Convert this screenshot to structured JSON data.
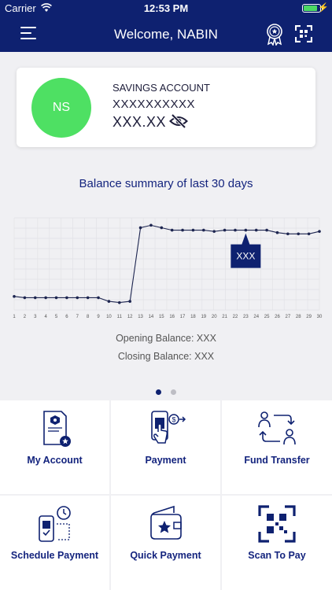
{
  "status_bar": {
    "carrier": "Carrier",
    "time": "12:53 PM"
  },
  "header": {
    "title": "Welcome, NABIN"
  },
  "account": {
    "initials": "NS",
    "type": "SAVINGS ACCOUNT",
    "number": "XXXXXXXXXX",
    "balance": "XXX.XX"
  },
  "summary": {
    "title": "Balance summary of last 30 days",
    "opening_label": "Opening Balance: XXX",
    "closing_label": "Closing Balance: XXX",
    "tooltip": "XXX"
  },
  "chart_data": {
    "type": "line",
    "x": [
      1,
      2,
      3,
      4,
      5,
      6,
      7,
      8,
      9,
      10,
      11,
      12,
      13,
      14,
      15,
      16,
      17,
      18,
      19,
      20,
      21,
      22,
      23,
      24,
      25,
      26,
      27,
      28,
      29,
      30
    ],
    "series": [
      {
        "values": [
          26,
          25,
          25,
          25,
          25,
          25,
          25,
          25,
          25,
          22,
          21,
          22,
          82,
          84,
          82,
          80,
          80,
          80,
          80,
          79,
          80,
          80,
          80,
          80,
          80,
          78,
          77,
          77,
          77,
          79
        ]
      }
    ],
    "ylim": [
      15,
      90
    ],
    "grid": true,
    "highlight_x": 23
  },
  "pagination": {
    "current": 1,
    "total": 2
  },
  "tiles": [
    {
      "label": "My Account",
      "icon": "account-document-icon"
    },
    {
      "label": "Payment",
      "icon": "phone-payment-icon"
    },
    {
      "label": "Fund Transfer",
      "icon": "fund-transfer-icon"
    },
    {
      "label": "Schedule Payment",
      "icon": "schedule-payment-icon"
    },
    {
      "label": "Quick Payment",
      "icon": "wallet-star-icon"
    },
    {
      "label": "Scan To Pay",
      "icon": "qr-code-icon"
    }
  ],
  "colors": {
    "primary": "#0e2170",
    "accent_text": "#14247e",
    "avatar": "#4ee063"
  }
}
